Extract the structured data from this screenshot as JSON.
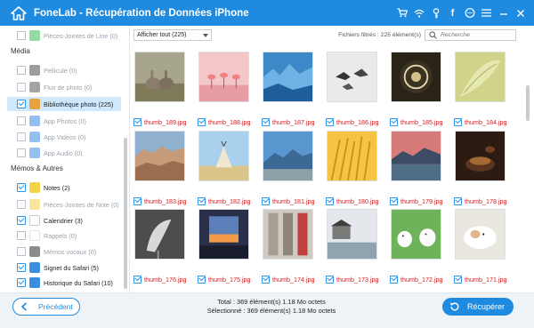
{
  "window": {
    "title": "FoneLab - Récupération de Données iPhone"
  },
  "sidebar": {
    "items": [
      {
        "label": "Pièces-Jointes de Line (0)",
        "dim": true,
        "checked": false,
        "icon": "line-icon",
        "color": "#3cbe57",
        "kind": "row"
      },
      {
        "label": "Média",
        "kind": "section"
      },
      {
        "label": "Pellicule (0)",
        "dim": true,
        "checked": false,
        "icon": "camera-roll-icon",
        "color": "#4a4a4a",
        "kind": "row"
      },
      {
        "label": "Flux de photo (0)",
        "dim": true,
        "checked": false,
        "icon": "photo-stream-icon",
        "color": "#5a5a5a",
        "kind": "row"
      },
      {
        "label": "Bibliothèque photo (225)",
        "dim": false,
        "checked": true,
        "icon": "photo-library-icon",
        "color": "#e8a33c",
        "kind": "row",
        "selected": true
      },
      {
        "label": "App Photos (0)",
        "dim": true,
        "checked": false,
        "icon": "app-photos-icon",
        "color": "#3b8de0",
        "kind": "row"
      },
      {
        "label": "App Vidéos (0)",
        "dim": true,
        "checked": false,
        "icon": "app-videos-icon",
        "color": "#3b8de0",
        "kind": "row"
      },
      {
        "label": "App Audio (0)",
        "dim": true,
        "checked": false,
        "icon": "app-audio-icon",
        "color": "#3b8de0",
        "kind": "row"
      },
      {
        "label": "Mémos & Autres",
        "kind": "section"
      },
      {
        "label": "Notes (2)",
        "dim": false,
        "checked": true,
        "icon": "notes-icon",
        "color": "#f4d24a",
        "kind": "row"
      },
      {
        "label": "Pièces-Jointes de Note (0)",
        "dim": true,
        "checked": false,
        "icon": "note-attachment-icon",
        "color": "#f4d24a",
        "kind": "row"
      },
      {
        "label": "Calendrier (3)",
        "dim": false,
        "checked": true,
        "icon": "calendar-icon",
        "color": "#ffffff",
        "kind": "row"
      },
      {
        "label": "Rappels (0)",
        "dim": true,
        "checked": false,
        "icon": "reminders-icon",
        "color": "#ffffff",
        "kind": "row"
      },
      {
        "label": "Mémos vocaux (0)",
        "dim": true,
        "checked": false,
        "icon": "voice-memo-icon",
        "color": "#2b2b2b",
        "kind": "row"
      },
      {
        "label": "Signet du Safari (5)",
        "dim": false,
        "checked": true,
        "icon": "safari-bookmark-icon",
        "color": "#3b8de0",
        "kind": "row"
      },
      {
        "label": "Historique du Safari (10)",
        "dim": false,
        "checked": true,
        "icon": "safari-history-icon",
        "color": "#3b8de0",
        "kind": "row"
      }
    ]
  },
  "toolbar": {
    "filter_value": "Afficher tout (225)",
    "files_selected": "Fichiers filtrés : 225 élément(s)",
    "search_placeholder": "Recherche"
  },
  "thumbnails": [
    {
      "name": "thumb_189.jpg",
      "scene": "rabbits"
    },
    {
      "name": "thumb_188.jpg",
      "scene": "flamingos"
    },
    {
      "name": "thumb_187.jpg",
      "scene": "ice"
    },
    {
      "name": "thumb_186.jpg",
      "scene": "birds"
    },
    {
      "name": "thumb_185.jpg",
      "scene": "ornament"
    },
    {
      "name": "thumb_184.jpg",
      "scene": "leaf"
    },
    {
      "name": "thumb_183.jpg",
      "scene": "badlands"
    },
    {
      "name": "thumb_182.jpg",
      "scene": "tipi"
    },
    {
      "name": "thumb_181.jpg",
      "scene": "mountains"
    },
    {
      "name": "thumb_180.jpg",
      "scene": "wheat"
    },
    {
      "name": "thumb_179.jpg",
      "scene": "lake"
    },
    {
      "name": "thumb_178.jpg",
      "scene": "tea"
    },
    {
      "name": "thumb_176.jpg",
      "scene": "calla"
    },
    {
      "name": "thumb_175.jpg",
      "scene": "window"
    },
    {
      "name": "thumb_174.jpg",
      "scene": "corridor"
    },
    {
      "name": "thumb_173.jpg",
      "scene": "village"
    },
    {
      "name": "thumb_172.jpg",
      "scene": "dogs"
    },
    {
      "name": "thumb_171.jpg",
      "scene": "puppy"
    }
  ],
  "footer": {
    "prev_label": "Précédent",
    "total": "Total : 369 élément(s) 1.18 Mo octets",
    "selected": "Sélectionné : 369 élément(s) 1.18 Mo octets",
    "recover_label": "Récupérer"
  },
  "colors": {
    "accent": "#1f8be0",
    "file_name": "#d22020",
    "selection": "#cfe8fb"
  }
}
